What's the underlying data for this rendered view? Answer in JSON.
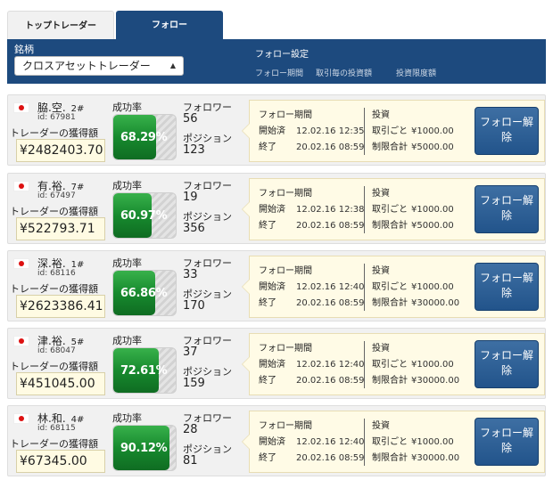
{
  "tabs": [
    {
      "label": "トップトレーダー",
      "active": false
    },
    {
      "label": "フォロー",
      "active": true
    }
  ],
  "header": {
    "symbol_label": "銘柄",
    "symbol_select": "クロスアセットトレーダー",
    "follow_settings_title": "フォロー設定",
    "columns": [
      "フォロー期間",
      "取引毎の投資額",
      "投資限度額"
    ]
  },
  "labels": {
    "earnings": "トレーダーの獲得額",
    "success_rate": "成功率",
    "followers": "フォロワー",
    "positions": "ポジション",
    "follow_period": "フォロー期間",
    "started": "開始済",
    "ended": "終了",
    "invest": "投資",
    "per_trade": "取引ごと",
    "limit_total": "制限合計",
    "unfollow_line1": "フォロー解",
    "unfollow_line2": "除"
  },
  "colors": {
    "brand_blue": "#1d4a7e",
    "success_green": "#178a2e",
    "flag_red": "#dd1111"
  },
  "traders": [
    {
      "name": "脇.空.",
      "rank": "2#",
      "id": "id: 67981",
      "earnings": "¥2482403.70",
      "success_rate": "68.29%",
      "success_pct": 68.29,
      "followers": "56",
      "positions": "123",
      "start": "12.02.16 12:35",
      "end": "20.02.16 08:59",
      "per_trade": "¥1000.00",
      "limit_total": "¥5000.00"
    },
    {
      "name": "有.裕.",
      "rank": "7#",
      "id": "id: 67497",
      "earnings": "¥522793.71",
      "success_rate": "60.97%",
      "success_pct": 60.97,
      "followers": "19",
      "positions": "356",
      "start": "12.02.16 12:38",
      "end": "20.02.16 08:59",
      "per_trade": "¥1000.00",
      "limit_total": "¥5000.00"
    },
    {
      "name": "深.裕.",
      "rank": "1#",
      "id": "id: 68116",
      "earnings": "¥2623386.41",
      "success_rate": "66.86%",
      "success_pct": 66.86,
      "followers": "33",
      "positions": "170",
      "start": "12.02.16 12:40",
      "end": "20.02.16 08:59",
      "per_trade": "¥1000.00",
      "limit_total": "¥30000.00"
    },
    {
      "name": "津.裕.",
      "rank": "5#",
      "id": "id: 68047",
      "earnings": "¥451045.00",
      "success_rate": "72.61%",
      "success_pct": 72.61,
      "followers": "37",
      "positions": "159",
      "start": "12.02.16 12:40",
      "end": "20.02.16 08:59",
      "per_trade": "¥1000.00",
      "limit_total": "¥30000.00"
    },
    {
      "name": "林.和.",
      "rank": "4#",
      "id": "id: 68115",
      "earnings": "¥67345.00",
      "success_rate": "90.12%",
      "success_pct": 90.12,
      "followers": "28",
      "positions": "81",
      "start": "12.02.16 12:40",
      "end": "20.02.16 08:59",
      "per_trade": "¥1000.00",
      "limit_total": "¥30000.00"
    }
  ]
}
